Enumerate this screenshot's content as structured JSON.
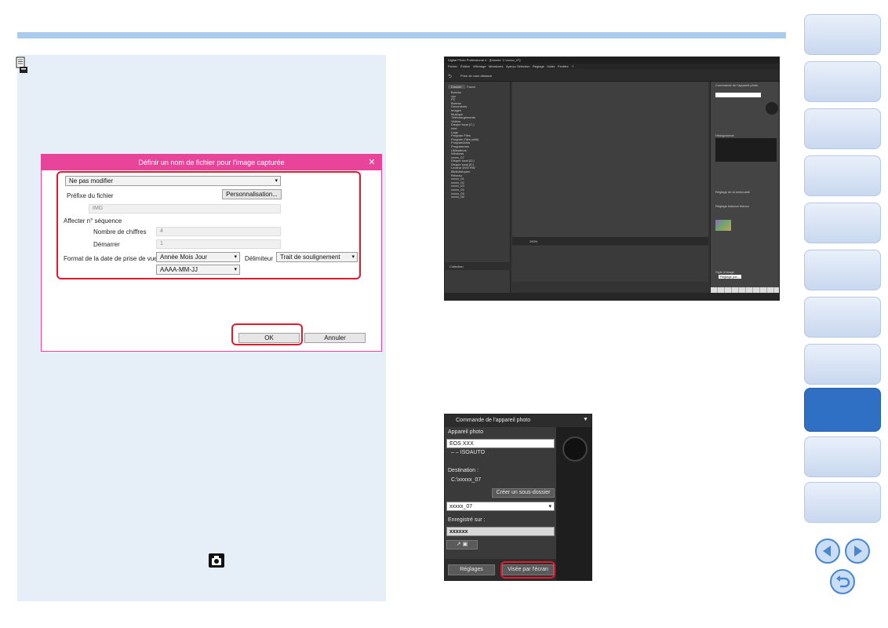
{
  "dialog": {
    "title": "Définir un nom de fichier pour l'image capturée",
    "close_glyph": "✕",
    "mode_select": "Ne pas modifier",
    "prefix_label": "Préfixe du fichier",
    "customize_button": "Personnalisation...",
    "prefix_value": "IMG",
    "sequence_label": "Affecter n° séquence",
    "digits_label": "Nombre de chiffres",
    "digits_value": "4",
    "start_label": "Démarrer",
    "start_value": "1",
    "date_format_label": "Format de la date de prise de vue",
    "date_order_select": "Année Mois Jour",
    "delimiter_label": "Délimiteur",
    "delimiter_select": "Trait de soulignement",
    "date_pattern_select": "AAAA-MM-JJ",
    "ok_button": "OK",
    "cancel_button": "Annuler"
  },
  "app_window": {
    "title": "Digital Photo Professional 4 - [Dossier: C:\\xxxxx_07]",
    "menus": [
      "Fichier",
      "Édition",
      "Affichage",
      "Miniatures",
      "Aperçu",
      "Sélection",
      "Réglage",
      "Outils",
      "Fenêtre",
      "?"
    ],
    "toolbar_title": "Prise de vues distance",
    "tabs": [
      "Dossier",
      "Favori"
    ],
    "tree": [
      "Bureau",
      "xyz",
      "PC",
      "Bureau",
      "Documents",
      "Images",
      "Musique",
      "Téléchargements",
      "Vidéos",
      "Disque local (C:)",
      "Intel",
      "Logs",
      "Program Files",
      "Program Files (x86)",
      "ProgramData",
      "Programmes",
      "Utilisateurs",
      "Windows",
      "xxxxx_07",
      "Disque local (D:)",
      "Disque local (E:)",
      "Lecteur DVD RW",
      "Bibliothèques",
      "Réseau",
      "xxxxx_01",
      "xxxxx_02",
      "xxxxx_03",
      "xxxxx_04",
      "xxxxx_05",
      "xxxxx_06"
    ],
    "collection_tab": "Collection",
    "zoom_value": "200%",
    "panel_title": "Commande de l'appareil photo",
    "histogram_label": "Histogramme",
    "tone_label": "Réglage de la luminosité",
    "wb_label": "Réglage balance blancs",
    "picture_style_label": "Style d'image",
    "picture_style_value": "Réglage par..."
  },
  "camera_panel": {
    "title": "Commande de l'appareil photo",
    "camera_label": "Appareil photo",
    "camera_value": "EOS XXX",
    "iso_text": "– –   ISOAUTO",
    "destination_label": "Destination :",
    "destination_value": "C:\\xxxxx_07",
    "subfolder_button": "Créer un sous-dossier",
    "folder_select": "xxxxx_07",
    "saved_on_label": "Enregistré sur :",
    "saved_on_value": "xxxxxx",
    "settings_button": "Réglages",
    "live_view_button": "Visée par l'écran"
  },
  "colors": {
    "dialog_accent": "#e8459a",
    "highlight": "#e5192e",
    "nav_active": "#2f6fc4",
    "rule": "#a9ccec",
    "note_bg": "#e6eef8"
  },
  "icons": [
    "memo-icon",
    "camera-icon",
    "previous-page-icon",
    "next-page-icon",
    "return-icon"
  ]
}
